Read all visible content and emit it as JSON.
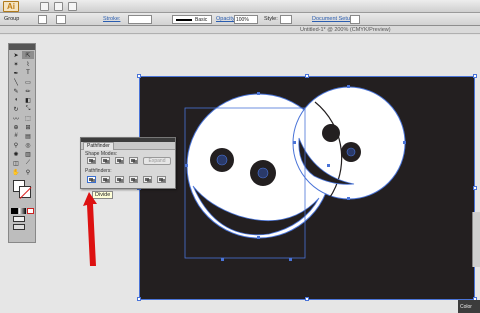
{
  "app": {
    "logo": "Ai"
  },
  "control_bar": {
    "selection_label": "Group",
    "stroke_label": "Stroke:",
    "brush_label": "Basic",
    "opacity_label": "Opacity:",
    "opacity_value": "100%",
    "style_label": "Style:",
    "document_setup_label": "Document Setup"
  },
  "document": {
    "title": "Untitled-1* @ 200% (CMYK/Preview)"
  },
  "pathfinder": {
    "tab_label": "Pathfinder",
    "shape_modes_label": "Shape Modes:",
    "pathfinders_label": "Pathfinders:",
    "expand_label": "Expand"
  },
  "tooltip": {
    "text": "Divide"
  },
  "color_panel": {
    "label": "Color"
  },
  "colors": {
    "artboard": "#231f20",
    "selection": "#4a74d8",
    "arrow": "#dd1111"
  }
}
